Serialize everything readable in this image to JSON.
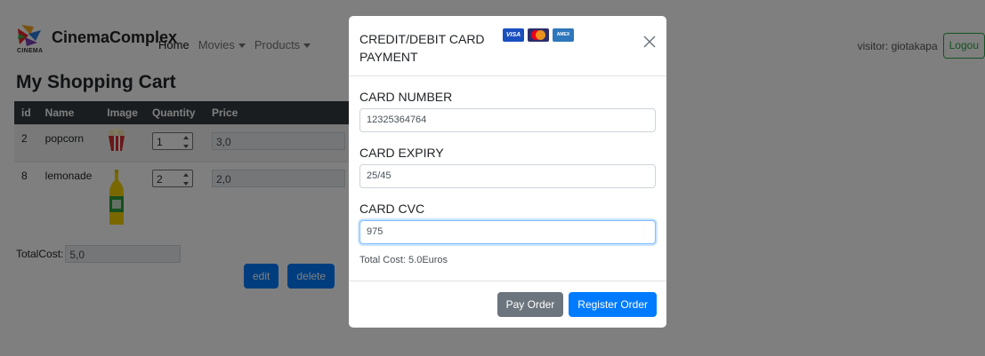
{
  "navbar": {
    "brand_name": "CinemaComplex",
    "logo_sub": "CINEMA",
    "links": [
      {
        "label": "Home"
      },
      {
        "label": "Movies"
      },
      {
        "label": "Products"
      }
    ],
    "visitor_text": "visitor: giotakapa",
    "logout_label": "Logou"
  },
  "cart": {
    "title": "My Shopping Cart",
    "columns": [
      "id",
      "Name",
      "Image",
      "Quantity",
      "Price"
    ],
    "rows": [
      {
        "id": "2",
        "name": "popcorn",
        "quantity": "1",
        "price": "3,0",
        "image_icon": "popcorn-icon"
      },
      {
        "id": "8",
        "name": "lemonade",
        "quantity": "2",
        "price": "2,0",
        "image_icon": "lemonade-bottle-icon"
      }
    ],
    "total_label": "TotalCost:",
    "total_value": "5,0",
    "buttons": {
      "edit": "edit",
      "delete": "delete"
    }
  },
  "modal": {
    "title": "CREDIT/DEBIT CARD PAYMENT",
    "card_brands": {
      "visa": "VISA",
      "mastercard": "mastercard-icon",
      "amex": "AMEX"
    },
    "fields": [
      {
        "label": "CARD NUMBER",
        "value": "12325364764"
      },
      {
        "label": "CARD EXPIRY",
        "value": "25/45"
      },
      {
        "label": "CARD CVC",
        "value": "975"
      }
    ],
    "total_cost": "Total Cost: 5.0Euros",
    "pay_label": "Pay Order",
    "register_label": "Register Order"
  },
  "colors": {
    "primary": "#007bff",
    "secondary": "#6c757d",
    "navbar_dark": "#343a40",
    "success": "#28a745"
  }
}
